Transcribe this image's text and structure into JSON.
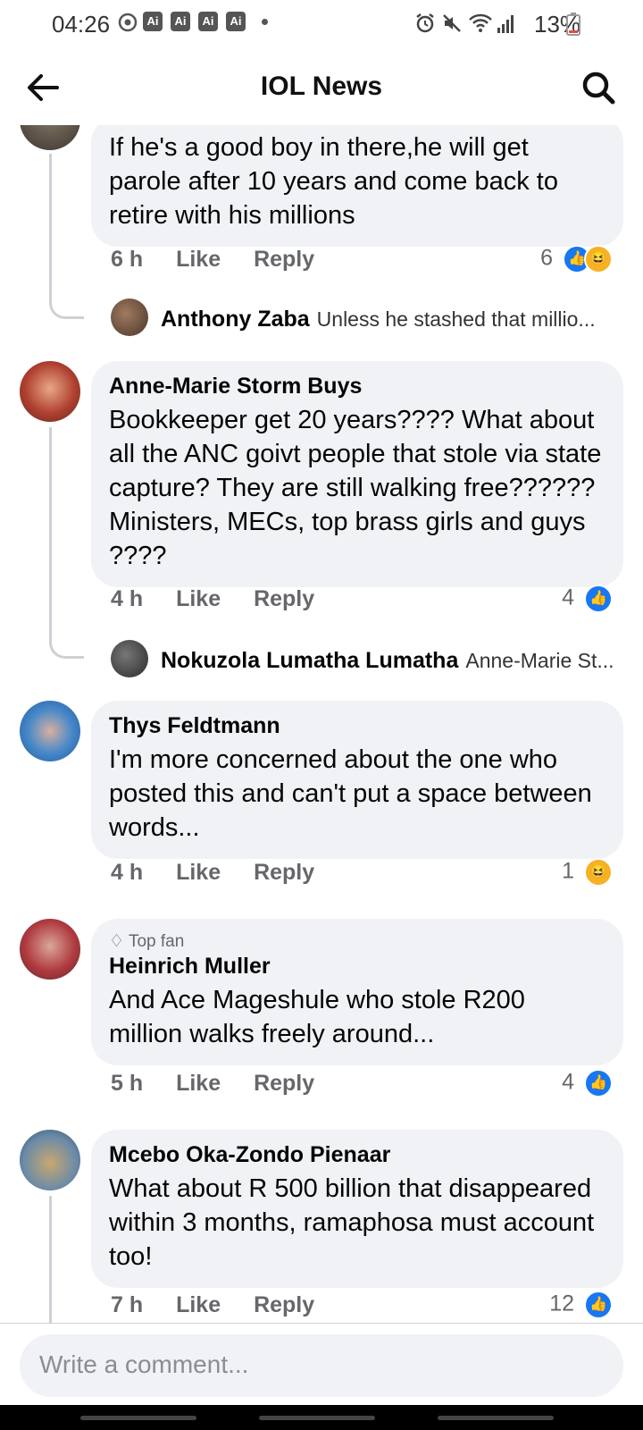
{
  "status_bar": {
    "time": "04:26",
    "ai_badges": [
      "Ai",
      "Ai",
      "Ai",
      "Ai"
    ],
    "battery": "13%",
    "icons": [
      "screen-record-icon",
      "alarm-icon",
      "mute-icon",
      "wifi-icon",
      "signal-icon",
      "battery-icon"
    ]
  },
  "header": {
    "title": "IOL News",
    "back_icon": "arrow-left-icon",
    "search_icon": "search-icon"
  },
  "comments": [
    {
      "author": "",
      "text": "If he's a good boy in there,he will get parole after 10 years and come back to retire with his millions",
      "time": "6 h",
      "like": "Like",
      "reply": "Reply",
      "reaction_count": "6",
      "reactions": [
        "like",
        "haha"
      ],
      "reply_preview": {
        "name": "Anthony Zaba",
        "text": "Unless he stashed that millio..."
      }
    },
    {
      "author": "Anne-Marie Storm Buys",
      "text": "Bookkeeper get 20 years???? What about all the ANC goivt people that stole via state capture?  They are still walking free??????  Ministers, MECs, top brass girls and guys ????",
      "time": "4 h",
      "like": "Like",
      "reply": "Reply",
      "reaction_count": "4",
      "reactions": [
        "like"
      ],
      "reply_preview": {
        "name": "Nokuzola Lumatha Lumatha",
        "text": "Anne-Marie St..."
      }
    },
    {
      "author": "Thys Feldtmann",
      "text": "I'm more concerned about the one who posted this and can't put a space between words...",
      "time": "4 h",
      "like": "Like",
      "reply": "Reply",
      "reaction_count": "1",
      "reactions": [
        "haha"
      ]
    },
    {
      "badge": "Top fan",
      "author": "Heinrich Muller",
      "text": "And Ace Mageshule who stole R200 million walks freely around...",
      "time": "5 h",
      "like": "Like",
      "reply": "Reply",
      "reaction_count": "4",
      "reactions": [
        "like"
      ]
    },
    {
      "author": "Mcebo Oka-Zondo Pienaar",
      "text": "What about R 500 billion that disappeared within 3 months, ramaphosa must account too!",
      "time": "7 h",
      "like": "Like",
      "reply": "Reply",
      "reaction_count": "12",
      "reactions": [
        "like"
      ]
    }
  ],
  "composer": {
    "placeholder": "Write a comment..."
  },
  "colors": {
    "bubble": "#f0f2f5",
    "like_blue": "#1877f2",
    "haha_yellow": "#f7b125",
    "meta_gray": "#65676b"
  }
}
